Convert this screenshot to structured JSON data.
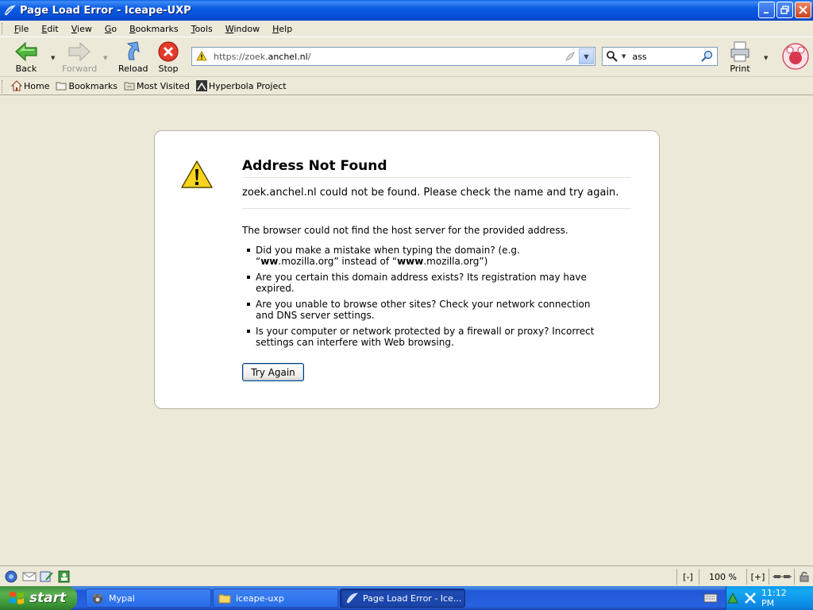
{
  "window": {
    "title": "Page Load Error - Iceape-UXP"
  },
  "menu": [
    "File",
    "Edit",
    "View",
    "Go",
    "Bookmarks",
    "Tools",
    "Window",
    "Help"
  ],
  "nav": {
    "back": "Back",
    "forward": "Forward",
    "reload": "Reload",
    "stop": "Stop",
    "print": "Print",
    "url_prefix": "https://zoek.",
    "url_host": "anchel.nl",
    "url_suffix": "/",
    "search_query": "ass"
  },
  "bookmarks": [
    "Home",
    "Bookmarks",
    "Most Visited",
    "Hyperbola Project"
  ],
  "error": {
    "title": "Address Not Found",
    "short": "zoek.anchel.nl could not be found. Please check the name and try again.",
    "long": "The browser could not find the host server for the provided address.",
    "items": [
      {
        "p1": "Did you make a mistake when typing the domain? (e.g. “",
        "b1": "ww",
        "p2": ".mozilla.org” instead of “",
        "b2": "www",
        "p3": ".mozilla.org”)"
      },
      {
        "text": "Are you certain this domain address exists? Its registration may have expired."
      },
      {
        "text": "Are you unable to browse other sites? Check your network connection and DNS server settings."
      },
      {
        "text": "Is your computer or network protected by a firewall or proxy? Incorrect settings can interfere with Web browsing."
      }
    ],
    "button": "Try Again"
  },
  "status": {
    "zoom_out": "[-]",
    "zoom": "100 %",
    "zoom_in": "[+]"
  },
  "taskbar": {
    "start": "start",
    "tasks": [
      "Mypal",
      "iceape-uxp",
      "Page Load Error - Ice..."
    ],
    "clock": "11:12 PM"
  }
}
